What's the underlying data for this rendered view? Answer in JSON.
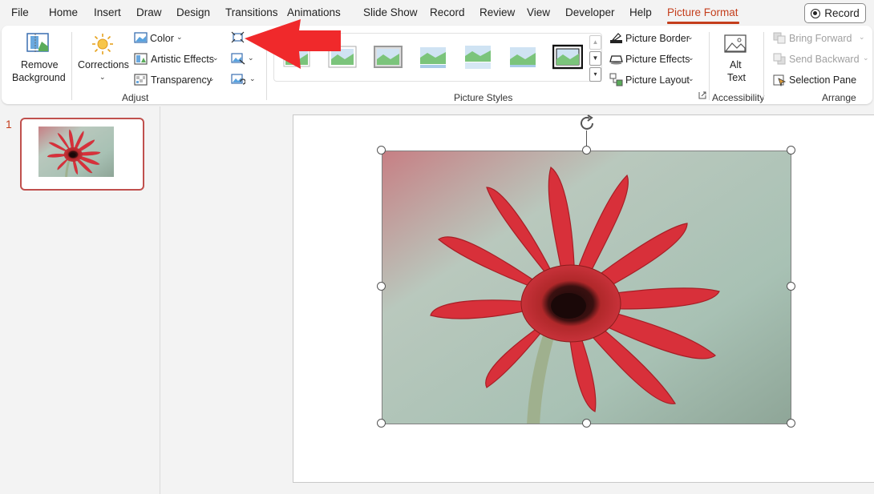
{
  "menu": {
    "items": [
      "File",
      "Home",
      "Insert",
      "Draw",
      "Design",
      "Transitions",
      "Animations",
      "Slide Show",
      "Record",
      "Review",
      "View",
      "Developer",
      "Help",
      "Picture Format"
    ],
    "active": "Picture Format",
    "record_label": "Record"
  },
  "ribbon": {
    "adjust": {
      "remove_bg_line1": "Remove",
      "remove_bg_line2": "Background",
      "corrections": "Corrections",
      "color": "Color",
      "artistic_effects": "Artistic Effects",
      "transparency": "Transparency",
      "group_label": "Adjust"
    },
    "picture_styles": {
      "group_label": "Picture Styles",
      "picture_border": "Picture Border",
      "picture_effects": "Picture Effects",
      "picture_layout": "Picture Layout"
    },
    "accessibility": {
      "alt_line1": "Alt",
      "alt_line2": "Text",
      "group_label": "Accessibility"
    },
    "arrange": {
      "bring_forward": "Bring Forward",
      "send_backward": "Send Backward",
      "selection_pane": "Selection Pane",
      "group_label": "Arrange"
    }
  },
  "slides": {
    "current_number": "1"
  },
  "colors": {
    "accent": "#c43e1c",
    "arrow": "#f0292b",
    "selected_thumb_border": "#c0504d"
  }
}
